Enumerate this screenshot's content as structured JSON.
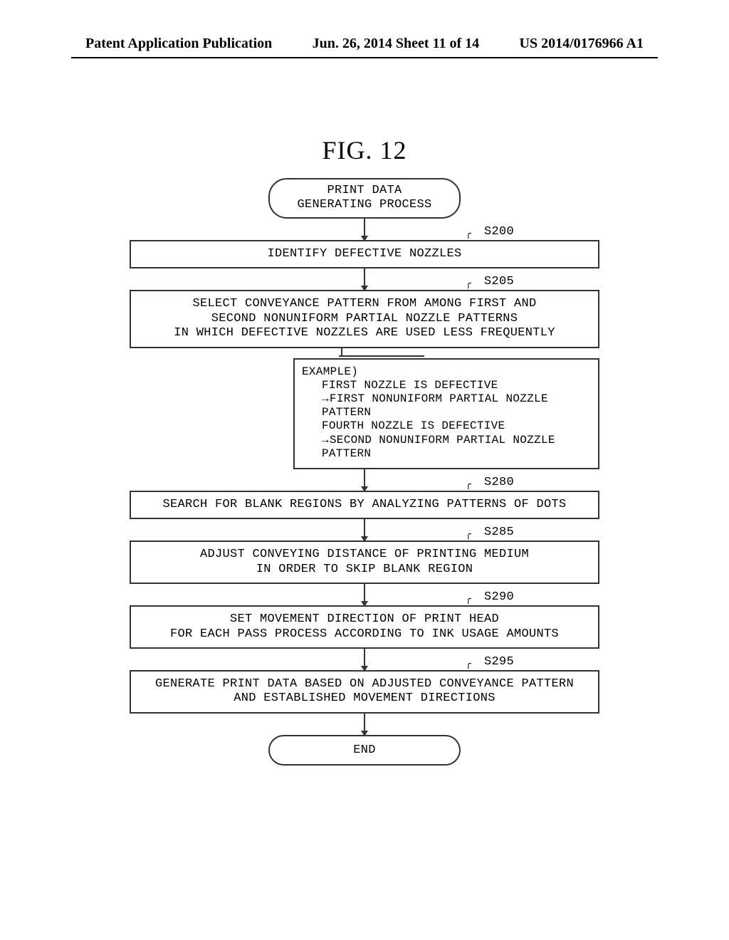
{
  "header": {
    "left": "Patent Application Publication",
    "center": "Jun. 26, 2014  Sheet 11 of 14",
    "right": "US 2014/0176966 A1"
  },
  "figure": {
    "label": "FIG. 12",
    "start": "PRINT DATA\nGENERATING PROCESS",
    "end": "END"
  },
  "steps": {
    "s200": {
      "ref": "S200",
      "text": "IDENTIFY DEFECTIVE NOZZLES"
    },
    "s205": {
      "ref": "S205",
      "text": "SELECT CONVEYANCE PATTERN FROM AMONG FIRST AND\nSECOND NONUNIFORM PARTIAL NOZZLE PATTERNS\nIN WHICH DEFECTIVE NOZZLES ARE USED LESS FREQUENTLY"
    },
    "s280": {
      "ref": "S280",
      "text": "SEARCH FOR BLANK REGIONS BY ANALYZING PATTERNS OF DOTS"
    },
    "s285": {
      "ref": "S285",
      "text": "ADJUST CONVEYING DISTANCE OF PRINTING MEDIUM\nIN ORDER TO SKIP BLANK REGION"
    },
    "s290": {
      "ref": "S290",
      "text": "SET MOVEMENT DIRECTION OF PRINT HEAD\nFOR EACH PASS PROCESS ACCORDING TO INK USAGE AMOUNTS"
    },
    "s295": {
      "ref": "S295",
      "text": "GENERATE PRINT DATA BASED ON ADJUSTED CONVEYANCE PATTERN\nAND ESTABLISHED MOVEMENT DIRECTIONS"
    }
  },
  "callout": {
    "title": "EXAMPLE)",
    "line1": "FIRST NOZZLE IS DEFECTIVE",
    "line2": "FIRST NONUNIFORM PARTIAL NOZZLE",
    "line2b": "PATTERN",
    "line3": "FOURTH NOZZLE IS DEFECTIVE",
    "line4": "SECOND NONUNIFORM PARTIAL NOZZLE",
    "line4b": "PATTERN"
  }
}
